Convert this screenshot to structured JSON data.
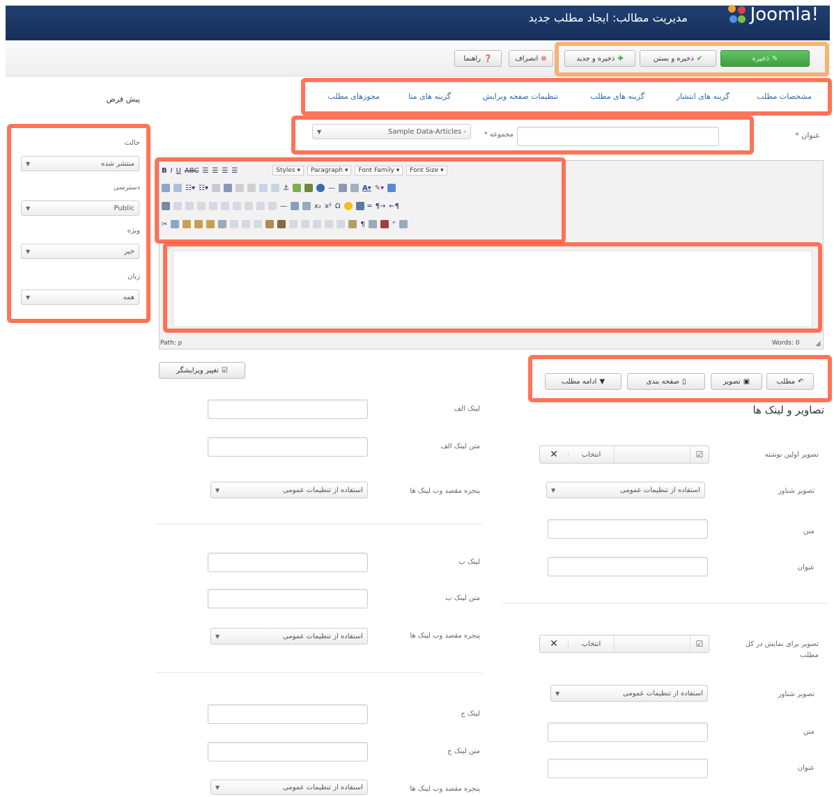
{
  "header": {
    "app_name": "Joomla!",
    "page_title": "مدیریت مطالب: ایجاد مطلب جدید"
  },
  "toolbar": {
    "save": "ذخیره",
    "save_close": "ذخیره و بستن",
    "save_new": "ذخیره و جدید",
    "cancel": "انصراف",
    "help": "راهنما"
  },
  "tabs": [
    "مشخصات مطلب",
    "گزینه های انتشار",
    "گزینه های مطلب",
    "تنظیمات صفحه ویرایش",
    "گزینه های متا",
    "مجوزهای مطلب"
  ],
  "sidebar": {
    "heading": "پیش فرض",
    "status": {
      "label": "حالت",
      "value": "منتشر شده"
    },
    "access": {
      "label": "دسترسی",
      "value": "Public"
    },
    "featured": {
      "label": "ویژه",
      "value": "خیر"
    },
    "language": {
      "label": "زبان",
      "value": "همه"
    }
  },
  "form": {
    "title_label": "عنوان *",
    "category_label": "مجموعه *",
    "category_value": "- Sample Data-Articles"
  },
  "editor": {
    "styles": "Styles",
    "paragraph": "Paragraph",
    "font_family": "Font Family",
    "font_size": "Font Size",
    "path": "Path: p",
    "words": "Words: 0",
    "toggle": "تغییر ویرایشگر"
  },
  "editor_buttons": {
    "article": "مطلب",
    "image": "تصویر",
    "pagebreak": "صفحه بندی",
    "readmore": "ادامه مطلب"
  },
  "images_links": {
    "heading": "تصاویر و لینک ها",
    "intro_image": "تصویر اولین نوشته",
    "select": "انتخاب",
    "float": "تصویر شناور",
    "use_global": "استفاده از تنظیمات عمومی",
    "alt": "متن",
    "caption": "عنوان",
    "full_image": "تصویر برای نمایش در کل مطلب",
    "link_a": "لینک الف",
    "link_a_text": "متن لینک الف",
    "target_window": "پنجره مقصد وب لینک ها",
    "link_b": "لینک ب",
    "link_b_text": "متن لینک ب",
    "link_c": "لینک ج",
    "link_c_text": "متن لینک ج"
  },
  "colors": {
    "header": "#1f3f72",
    "save_green": "#4aad4a",
    "annotation_red": "#ff5a3c",
    "annotation_orange": "#f5a85a",
    "tab_link": "#2a6ab0"
  }
}
